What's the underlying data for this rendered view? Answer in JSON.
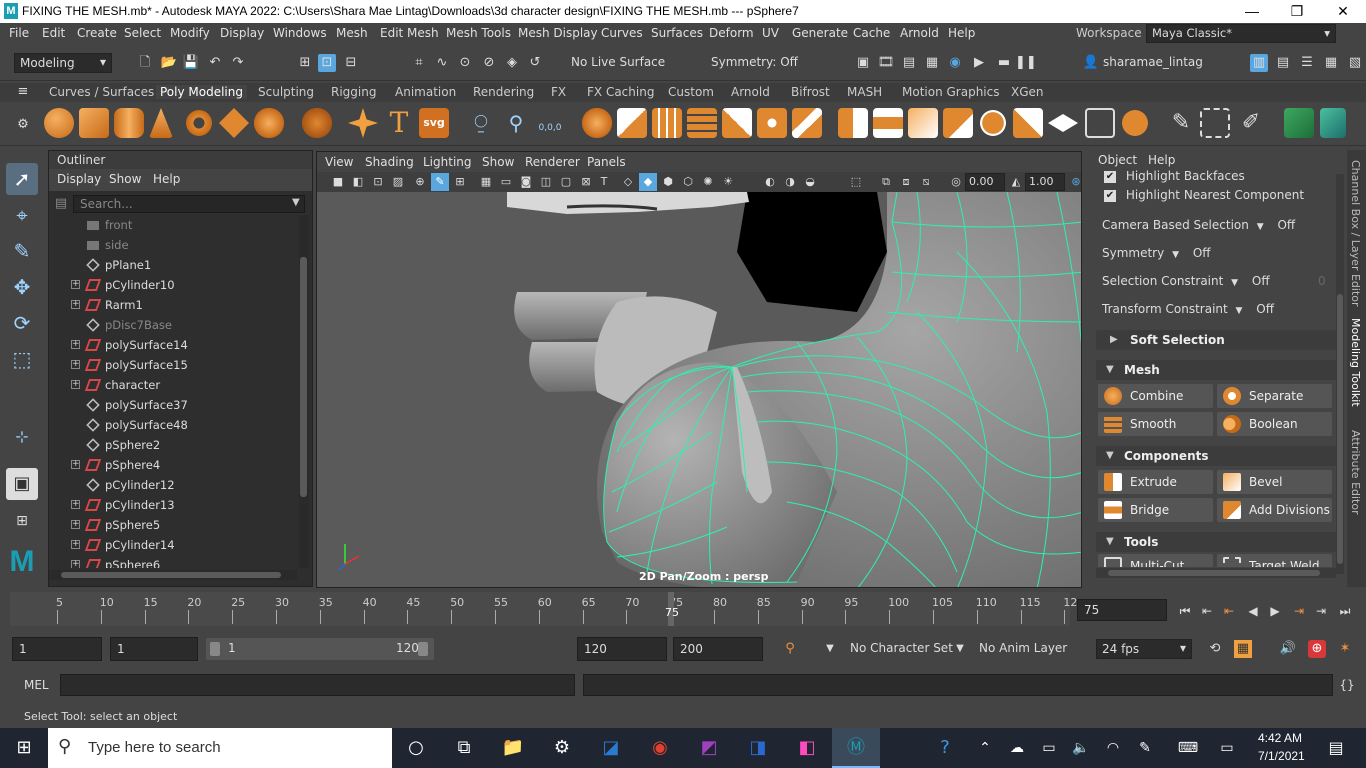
{
  "window": {
    "title": "FIXING THE MESH.mb* - Autodesk MAYA 2022: C:\\Users\\Shara Mae Lintag\\Downloads\\3d character design\\FIXING THE MESH.mb  ---  pSphere7",
    "logo_letter": "M",
    "minimize": "—",
    "restore": "❐",
    "close": "✕"
  },
  "menubar": {
    "items": [
      "File",
      "Edit",
      "Create",
      "Select",
      "Modify",
      "Display",
      "Windows",
      "Mesh",
      "Edit Mesh",
      "Mesh Tools",
      "Mesh Display",
      "Curves",
      "Surfaces",
      "Deform",
      "UV",
      "Generate",
      "Cache",
      "Arnold",
      "Help"
    ],
    "workspace_label": "Workspace :",
    "workspace_value": "Maya Classic*"
  },
  "statusline": {
    "menuset": "Modeling",
    "live_surface": "No Live Surface",
    "symmetry": "Symmetry: Off",
    "user": "sharamae_lintag"
  },
  "shelf": {
    "tabs": [
      "Curves / Surfaces",
      "Poly Modeling",
      "Sculpting",
      "Rigging",
      "Animation",
      "Rendering",
      "FX",
      "FX Caching",
      "Custom",
      "Arnold",
      "Bifrost",
      "MASH",
      "Motion Graphics",
      "XGen"
    ],
    "active_tab": "Poly Modeling",
    "text_icon": "T",
    "svg_icon": "svg",
    "coord_icon": "0,0,0"
  },
  "outliner": {
    "title": "Outliner",
    "menu": [
      "Display",
      "Show",
      "Help"
    ],
    "search_placeholder": "Search...",
    "rows": [
      {
        "name": "front",
        "expand": false,
        "dim": true,
        "type": "camera"
      },
      {
        "name": "side",
        "expand": false,
        "dim": true,
        "type": "camera"
      },
      {
        "name": "pPlane1",
        "expand": false,
        "dim": false,
        "type": "mesh"
      },
      {
        "name": "pCylinder10",
        "expand": true,
        "dim": false,
        "type": "joint"
      },
      {
        "name": "Rarm1",
        "expand": true,
        "dim": false,
        "type": "joint"
      },
      {
        "name": "pDisc7Base",
        "expand": false,
        "dim": true,
        "type": "mesh"
      },
      {
        "name": "polySurface14",
        "expand": true,
        "dim": false,
        "type": "joint"
      },
      {
        "name": "polySurface15",
        "expand": true,
        "dim": false,
        "type": "joint"
      },
      {
        "name": "character",
        "expand": true,
        "dim": false,
        "type": "joint"
      },
      {
        "name": "polySurface37",
        "expand": false,
        "dim": false,
        "type": "mesh"
      },
      {
        "name": "polySurface48",
        "expand": false,
        "dim": false,
        "type": "mesh"
      },
      {
        "name": "pSphere2",
        "expand": false,
        "dim": false,
        "type": "mesh"
      },
      {
        "name": "pSphere4",
        "expand": true,
        "dim": false,
        "type": "joint"
      },
      {
        "name": "pCylinder12",
        "expand": false,
        "dim": false,
        "type": "mesh"
      },
      {
        "name": "pCylinder13",
        "expand": true,
        "dim": false,
        "type": "joint"
      },
      {
        "name": "pSphere5",
        "expand": true,
        "dim": false,
        "type": "joint"
      },
      {
        "name": "pCylinder14",
        "expand": true,
        "dim": false,
        "type": "joint"
      },
      {
        "name": "pSphere6",
        "expand": true,
        "dim": false,
        "type": "joint"
      }
    ]
  },
  "viewport": {
    "menu": [
      "View",
      "Shading",
      "Lighting",
      "Show",
      "Renderer",
      "Panels"
    ],
    "exposure": "0.00",
    "gamma": "1.00",
    "hud_label": "2D Pan/Zoom : persp"
  },
  "modeling_toolkit": {
    "menu": [
      "Object",
      "Help"
    ],
    "highlight_backfaces": "Highlight Backfaces",
    "highlight_nearest": "Highlight Nearest Component",
    "camera_based_selection": {
      "label": "Camera Based Selection",
      "value": "Off"
    },
    "symmetry": {
      "label": "Symmetry",
      "value": "Off"
    },
    "selection_constraint": {
      "label": "Selection Constraint",
      "value": "Off",
      "extra": "0"
    },
    "transform_constraint": {
      "label": "Transform Constraint",
      "value": "Off"
    },
    "soft_selection": "Soft Selection",
    "mesh_section": "Mesh",
    "mesh_buttons": [
      "Combine",
      "Separate",
      "Smooth",
      "Boolean"
    ],
    "components_section": "Components",
    "component_buttons": [
      "Extrude",
      "Bevel",
      "Bridge",
      "Add Divisions"
    ],
    "tools_section": "Tools",
    "tool_buttons": [
      "Multi-Cut",
      "Target Weld"
    ]
  },
  "side_tabs": [
    "Channel Box / Layer Editor",
    "Modeling Toolkit",
    "Attribute Editor"
  ],
  "timeslider": {
    "ticks": [
      "5",
      "10",
      "15",
      "20",
      "25",
      "30",
      "35",
      "40",
      "45",
      "50",
      "55",
      "60",
      "65",
      "70",
      "75",
      "80",
      "85",
      "90",
      "95",
      "100",
      "105",
      "110",
      "115",
      "12"
    ],
    "current": "75",
    "current_frame_field": "75"
  },
  "range": {
    "start": "1",
    "playback_start": "1",
    "slider_start": "1",
    "slider_end": "120",
    "playback_end": "120",
    "end": "200",
    "character_set": "No Character Set",
    "anim_layer": "No Anim Layer",
    "fps": "24 fps"
  },
  "command": {
    "label": "MEL"
  },
  "help_line": "Select Tool: select an object",
  "taskbar": {
    "search_placeholder": "Type here to search",
    "time": "4:42 AM",
    "date": "7/1/2021"
  },
  "colors": {
    "wireframe": "#2df0b0",
    "accent_blue": "#5aa7e0"
  }
}
